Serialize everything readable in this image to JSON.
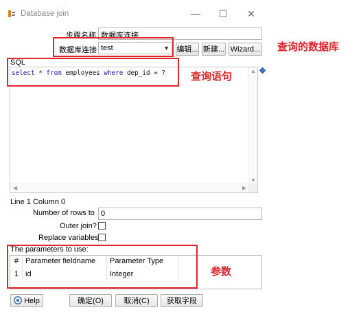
{
  "window": {
    "title": "Database join",
    "minimize_glyph": "—",
    "maximize_glyph": "☐",
    "close_glyph": "✕"
  },
  "form": {
    "step_name_label": "步骤名称",
    "step_name_value": "数据库连接",
    "connection_label": "数据库连接",
    "connection_value": "test",
    "edit_button": "编辑...",
    "new_button": "新建...",
    "wizard_button": "Wizard..."
  },
  "sql": {
    "label": "SQL",
    "kw_select": "select",
    "star": " * ",
    "kw_from": "from",
    "table_name": " employees ",
    "kw_where": "where",
    "condition": " dep_id = ?"
  },
  "position": {
    "text": "Line 1 Column 0"
  },
  "options": {
    "rows_label": "Number of rows to",
    "rows_value": "0",
    "outer_join_label": "Outer join?",
    "replace_vars_label": "Replace variables"
  },
  "parameters": {
    "label": "The parameters to use:",
    "columns": [
      "#",
      "Parameter fieldname",
      "Parameter Type"
    ],
    "rows": [
      {
        "num": "1",
        "field": "id",
        "type": "Integer"
      }
    ]
  },
  "footer": {
    "help_button": "Help",
    "ok_button": "确定(O)",
    "cancel_button": "取消(C)",
    "get_fields_button": "获取字段"
  },
  "annotations": {
    "database": "查询的数据库",
    "query": "查询语句",
    "params": "参数"
  },
  "colors": {
    "annotation": "#e0252b",
    "sql_keyword": "#1a1aa8"
  }
}
